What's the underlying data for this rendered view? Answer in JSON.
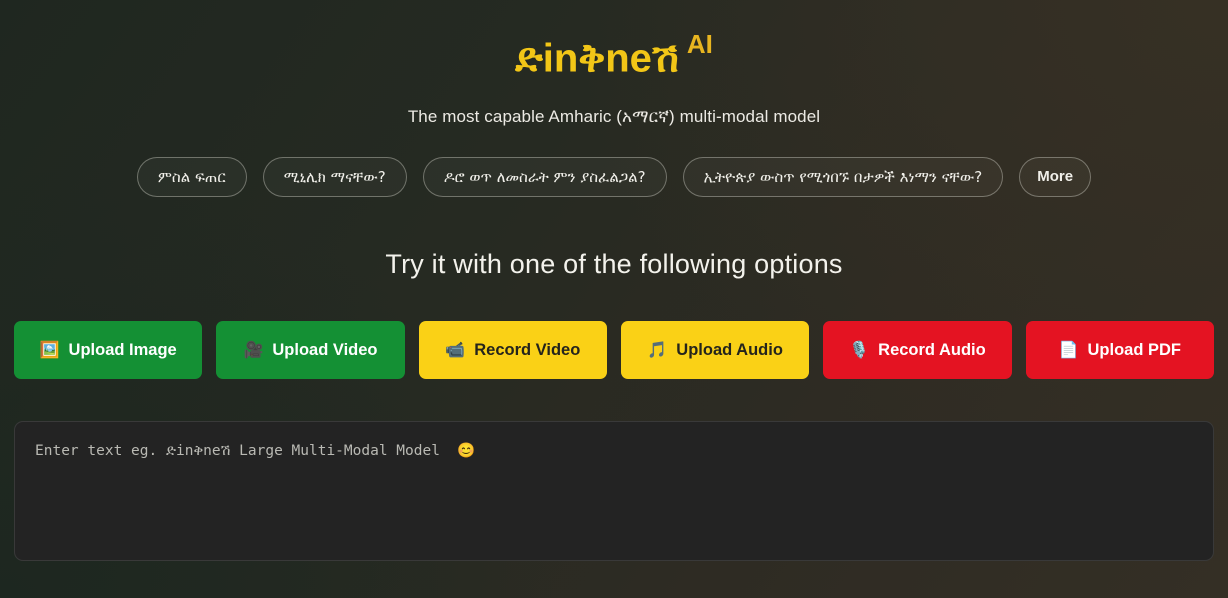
{
  "header": {
    "brand_name": "ድinቅneሽ",
    "brand_suffix": "AI",
    "subtitle": "The most capable Amharic (አማርኛ) multi-modal model"
  },
  "suggestions": {
    "chips": [
      {
        "label": "ምስል ፍጠር"
      },
      {
        "label": "ሚኒሊክ ማናቸው?"
      },
      {
        "label": "ዶሮ ወጥ ለመስራት ምን ያስፈልጋል?"
      },
      {
        "label": "ኢትዮጵያ ውስጥ የሚጎበኙ በታዎች እነማን ናቸው?"
      }
    ],
    "more_label": "More"
  },
  "options": {
    "section_title": "Try it with one of the following options",
    "buttons": [
      {
        "label": "Upload Image",
        "icon": "🖼️",
        "icon_name": "image-icon",
        "color": "#149034",
        "style": "green"
      },
      {
        "label": "Upload Video",
        "icon": "🎥",
        "icon_name": "video-icon",
        "color": "#149034",
        "style": "green"
      },
      {
        "label": "Record Video",
        "icon": "📹",
        "icon_name": "camcorder-icon",
        "color": "#fad116",
        "style": "yellow"
      },
      {
        "label": "Upload Audio",
        "icon": "🎵",
        "icon_name": "music-note-icon",
        "color": "#fad116",
        "style": "yellow"
      },
      {
        "label": "Record Audio",
        "icon": "🎙️",
        "icon_name": "microphone-icon",
        "color": "#e41322",
        "style": "red"
      },
      {
        "label": "Upload PDF",
        "icon": "📄",
        "icon_name": "document-icon",
        "color": "#e41322",
        "style": "red"
      }
    ]
  },
  "prompt": {
    "placeholder": "Enter text eg. ድinቅneሽ Large Multi-Modal Model  😊",
    "value": ""
  },
  "theme": {
    "background_start": "#1f2720",
    "background_end": "#342f25",
    "brand_color": "#f2c617",
    "text_color": "#eceae4"
  }
}
